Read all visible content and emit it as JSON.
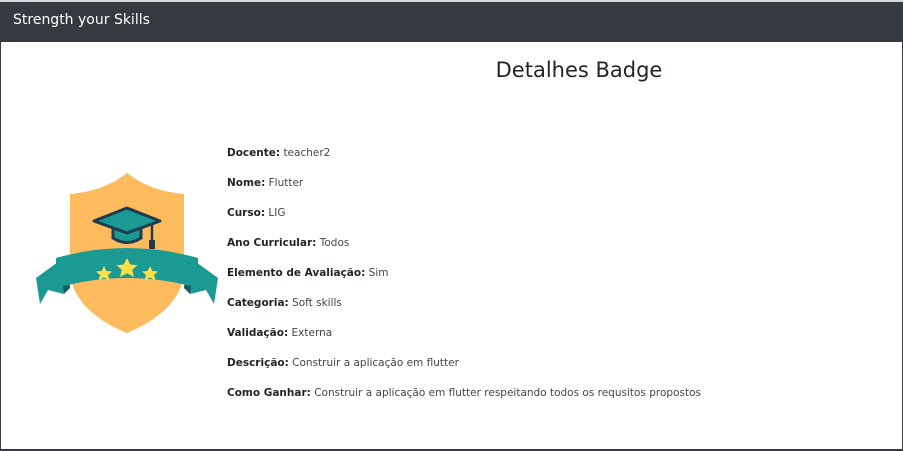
{
  "navbar": {
    "brand": "Strength your Skills"
  },
  "page": {
    "title": "Detalhes Badge"
  },
  "badge": {
    "icon": "graduation-badge-icon",
    "colors": {
      "shield": "#fdbb5e",
      "ribbon": "#1a9a93",
      "ribbon_dark": "#0f5e5a",
      "cap": "#1a9a93",
      "stars": "#fde047"
    }
  },
  "details": [
    {
      "label": "Docente:",
      "value": "teacher2"
    },
    {
      "label": "Nome:",
      "value": "Flutter"
    },
    {
      "label": "Curso:",
      "value": "LIG"
    },
    {
      "label": "Ano Curricular:",
      "value": "Todos"
    },
    {
      "label": "Elemento de Avaliação:",
      "value": "Sim"
    },
    {
      "label": "Categoria:",
      "value": "Soft skills"
    },
    {
      "label": "Validação:",
      "value": "Externa"
    },
    {
      "label": "Descrição:",
      "value": "Construir a aplicação em flutter"
    },
    {
      "label": "Como Ganhar:",
      "value": "Construir a aplicação em flutter respeitando todos os requsitos propostos"
    }
  ]
}
